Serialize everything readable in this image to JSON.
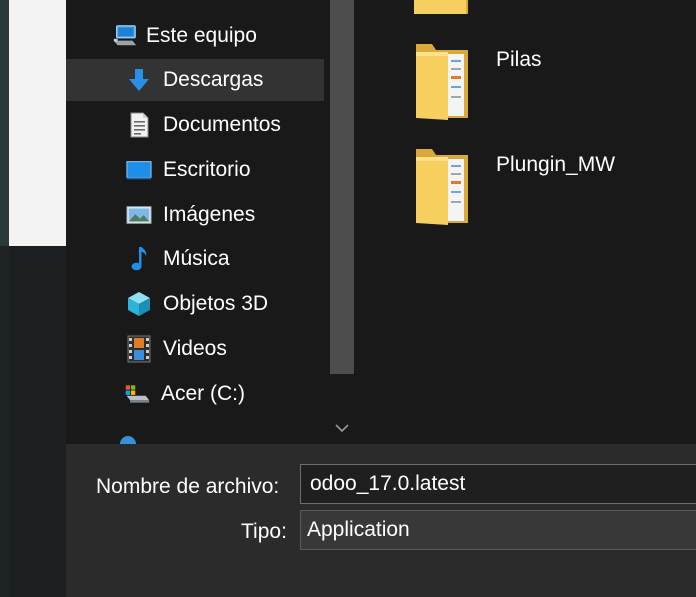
{
  "navigation": {
    "items": [
      {
        "label": "Este equipo",
        "icon": "computer-icon",
        "selected": false
      },
      {
        "label": "Descargas",
        "icon": "download-arrow-icon",
        "selected": true
      },
      {
        "label": "Documentos",
        "icon": "document-icon",
        "selected": false
      },
      {
        "label": "Escritorio",
        "icon": "desktop-icon",
        "selected": false
      },
      {
        "label": "Imágenes",
        "icon": "pictures-icon",
        "selected": false
      },
      {
        "label": "Música",
        "icon": "music-note-icon",
        "selected": false
      },
      {
        "label": "Objetos 3D",
        "icon": "cube-3d-icon",
        "selected": false
      },
      {
        "label": "Videos",
        "icon": "film-strip-icon",
        "selected": false
      },
      {
        "label": "Acer (C:)",
        "icon": "drive-icon",
        "selected": false
      }
    ]
  },
  "files": {
    "items": [
      {
        "name": "Pilas",
        "icon": "folder-icon"
      },
      {
        "name": "Plungin_MW",
        "icon": "folder-icon"
      }
    ]
  },
  "footer": {
    "filename_label": "Nombre de archivo:",
    "filename_value": "odoo_17.0.latest",
    "type_label": "Tipo:",
    "type_value": "Application"
  },
  "colors": {
    "background": "#191919",
    "selected_row": "#333333",
    "bottom_panel": "#2b2b2b",
    "accent_blue": "#1e90e8",
    "folder_yellow": "#f5c84c"
  }
}
